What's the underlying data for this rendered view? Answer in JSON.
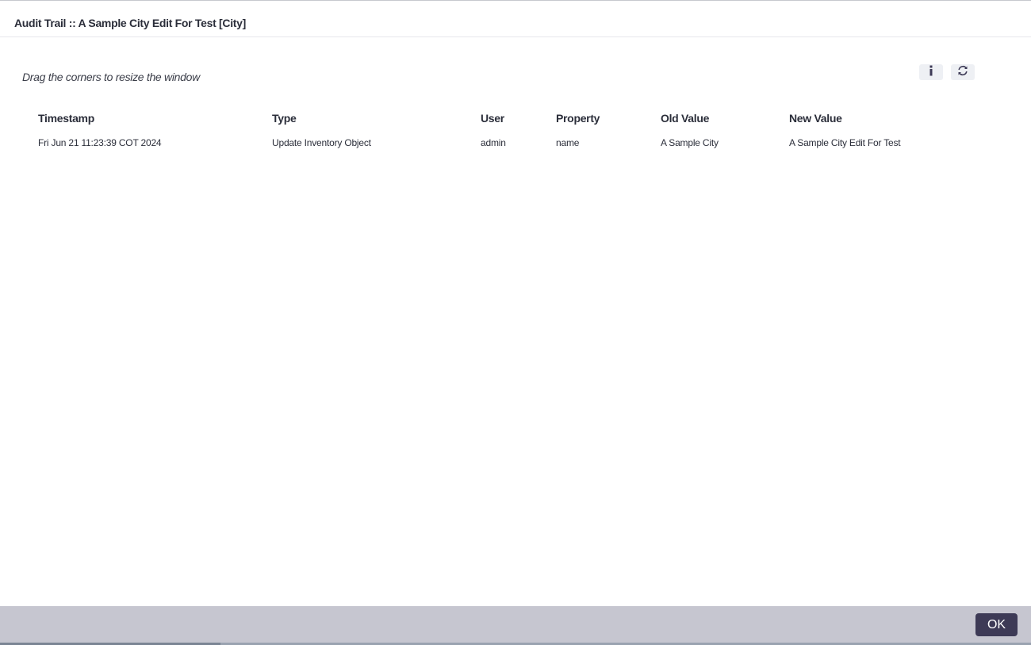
{
  "window": {
    "title": "Audit Trail :: A Sample City Edit For Test [City]",
    "hint": "Drag the corners to resize the window"
  },
  "toolbar": {
    "info_icon": "info-icon",
    "refresh_icon": "refresh-icon"
  },
  "table": {
    "columns": [
      "Timestamp",
      "Type",
      "User",
      "Property",
      "Old Value",
      "New Value"
    ],
    "rows": [
      [
        "Fri Jun 21 11:23:39 COT 2024",
        "Update Inventory Object",
        "admin",
        "name",
        "A Sample City",
        "A Sample City Edit For Test"
      ]
    ]
  },
  "footer": {
    "ok_label": "OK"
  },
  "colors": {
    "accent": "#3d3a56",
    "footer_bg": "#c6c6d0"
  }
}
